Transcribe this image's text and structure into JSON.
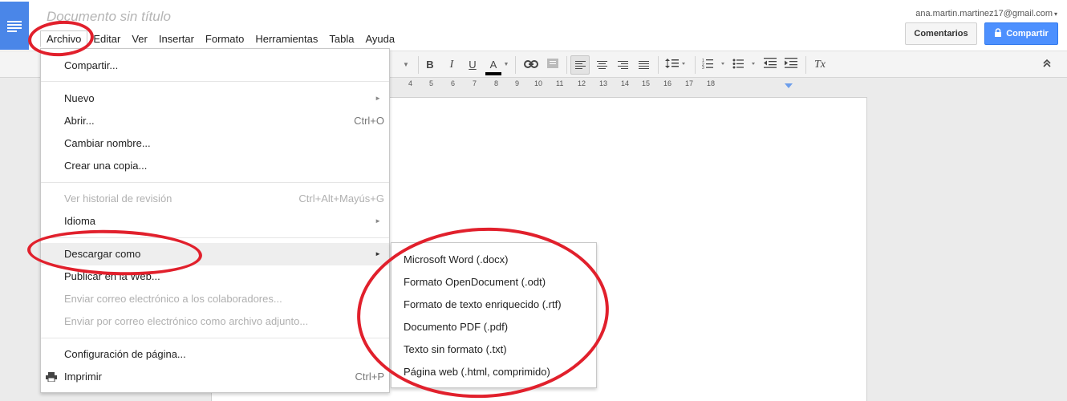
{
  "document": {
    "title": "Documento sin título"
  },
  "account": {
    "email": "ana.martin.martinez17@gmail.com",
    "caret": "▾"
  },
  "menubar": {
    "items": [
      "Archivo",
      "Editar",
      "Ver",
      "Insertar",
      "Formato",
      "Herramientas",
      "Tabla",
      "Ayuda"
    ]
  },
  "header_buttons": {
    "comments_label": "Comentarios",
    "share_label": "Compartir",
    "share_icon": "lock-icon"
  },
  "toolbar": {
    "bold": "B",
    "italic": "I",
    "underline": "U",
    "text_color": "A",
    "clear_format": "Tx",
    "collapse": "⌃",
    "icons": [
      "bold-icon",
      "italic-icon",
      "underline-icon",
      "text-color-icon",
      "link-icon",
      "comment-icon",
      "align-left-icon",
      "align-center-icon",
      "align-right-icon",
      "align-justify-icon",
      "line-spacing-icon",
      "numbered-list-icon",
      "bulleted-list-icon",
      "decrease-indent-icon",
      "increase-indent-icon",
      "clear-formatting-icon",
      "collapse-icon"
    ]
  },
  "ruler": {
    "ticks": [
      "4",
      "5",
      "6",
      "7",
      "8",
      "9",
      "10",
      "11",
      "12",
      "13",
      "14",
      "15",
      "16",
      "17",
      "18"
    ]
  },
  "file_menu": {
    "items": [
      {
        "label": "Compartir...",
        "shortcut": "",
        "submenu": false,
        "disabled": false
      },
      {
        "label": "Nuevo",
        "shortcut": "",
        "submenu": true,
        "disabled": false
      },
      {
        "label": "Abrir...",
        "shortcut": "Ctrl+O",
        "submenu": false,
        "disabled": false
      },
      {
        "label": "Cambiar nombre...",
        "shortcut": "",
        "submenu": false,
        "disabled": false
      },
      {
        "label": "Crear una copia...",
        "shortcut": "",
        "submenu": false,
        "disabled": false
      },
      {
        "label": "Ver historial de revisión",
        "shortcut": "Ctrl+Alt+Mayús+G",
        "submenu": false,
        "disabled": true
      },
      {
        "label": "Idioma",
        "shortcut": "",
        "submenu": true,
        "disabled": false
      },
      {
        "label": "Descargar como",
        "shortcut": "",
        "submenu": true,
        "disabled": false
      },
      {
        "label": "Publicar en la Web...",
        "shortcut": "",
        "submenu": false,
        "disabled": false
      },
      {
        "label": "Enviar correo electrónico a los colaboradores...",
        "shortcut": "",
        "submenu": false,
        "disabled": true
      },
      {
        "label": "Enviar por correo electrónico como archivo adjunto...",
        "shortcut": "",
        "submenu": false,
        "disabled": true
      },
      {
        "label": "Configuración de página...",
        "shortcut": "",
        "submenu": false,
        "disabled": false
      },
      {
        "label": "Imprimir",
        "shortcut": "Ctrl+P",
        "submenu": false,
        "disabled": false,
        "icon": "printer-icon"
      }
    ],
    "submenu_arrow": "►"
  },
  "download_submenu": {
    "items": [
      "Microsoft Word (.docx)",
      "Formato OpenDocument (.odt)",
      "Formato de texto enriquecido (.rtf)",
      "Documento PDF (.pdf)",
      "Texto sin formato (.txt)",
      "Página web (.html, comprimido)"
    ]
  },
  "annotations": {
    "color": "#e1202c"
  },
  "colors": {
    "brand_blue": "#4a86e8",
    "share_button": "#4d90fe",
    "text_color_bar": "#000000"
  }
}
